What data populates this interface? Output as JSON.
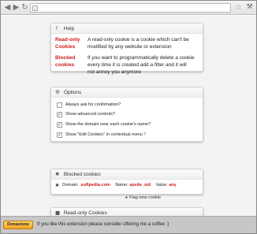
{
  "browser": {
    "back_icon": "arrow-left-icon",
    "forward_icon": "arrow-right-icon",
    "reload_icon": "reload-icon",
    "address_value": ""
  },
  "help": {
    "title": "Help",
    "icon": "help-icon",
    "items": [
      {
        "term_line1": "Read-only",
        "term_line2": "Cookies",
        "desc_line1": "A read-only cookie is a cookie which can't be",
        "desc_line2": "modified by any website or extension"
      },
      {
        "term_line1": "Blocked",
        "term_line2": "cookies",
        "desc_line1": "If you want to programmatically delete a cookie",
        "desc_line2": "every time it is created add a filter and it will",
        "desc_line3": "not annoy you anymore"
      }
    ]
  },
  "options": {
    "title": "Options",
    "icon": "wrench-icon",
    "items": [
      {
        "label": "Always ask for confirmation?",
        "checked": false
      },
      {
        "label": "Show advanced controls?",
        "checked": true
      },
      {
        "label": "Show the domain near each cookie's name?",
        "checked": true
      },
      {
        "label": "Show \"Edit Cookies\" in contextual menu",
        "checked": true,
        "hint": "?"
      }
    ]
  },
  "blocked": {
    "title": "Blocked cookies",
    "icon": "close-icon",
    "row": {
      "domain_label": "Domain:",
      "domain_value": ".softpedia.com",
      "name_label": "Name:",
      "name_value": "spsite_sid",
      "value_label": "Value:",
      "value_value": "any"
    },
    "flag_link": "Flag new cookie"
  },
  "readonly": {
    "title": "Read-only Cookies",
    "icon": "lock-icon"
  },
  "footer": {
    "donate_label": "Donazione",
    "message": "If you like this extension please consider offering me a coffee :)"
  }
}
